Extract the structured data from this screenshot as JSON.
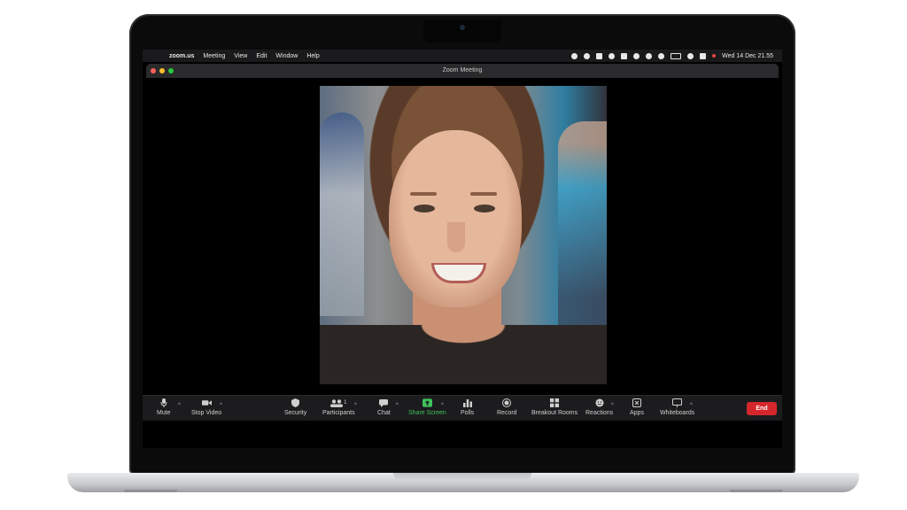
{
  "menubar": {
    "app_name": "zoom.us",
    "menus": [
      "Meeting",
      "View",
      "Edit",
      "Window",
      "Help"
    ],
    "clock": "Wed 14 Dec  21.55"
  },
  "window": {
    "title": "Zoom Meeting"
  },
  "toolbar": {
    "mute_label": "Mute",
    "stop_video_label": "Stop Video",
    "security_label": "Security",
    "participants_label": "Participants",
    "participants_count": "1",
    "chat_label": "Chat",
    "share_screen_label": "Share Screen",
    "polls_label": "Polls",
    "record_label": "Record",
    "breakout_rooms_label": "Breakout Rooms",
    "reactions_label": "Reactions",
    "apps_label": "Apps",
    "whiteboards_label": "Whiteboards",
    "end_label": "End",
    "share_color": "#3dc45b",
    "end_color": "#d5272b"
  },
  "icons": {
    "mute": "microphone-icon",
    "video": "video-camera-icon",
    "security": "shield-icon",
    "participants": "people-icon",
    "chat": "speech-bubble-icon",
    "share": "share-arrow-icon",
    "polls": "bar-chart-icon",
    "record": "record-dot-icon",
    "breakout": "grid-icon",
    "reactions": "smiley-icon",
    "apps": "apps-icon",
    "whiteboards": "whiteboard-icon"
  }
}
